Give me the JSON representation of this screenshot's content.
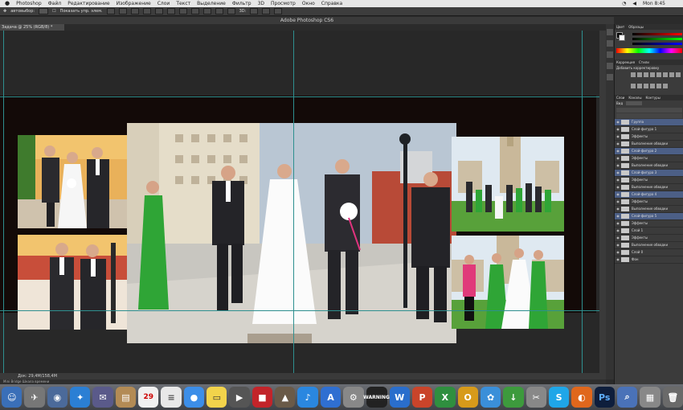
{
  "menubar": {
    "apple": "",
    "items": [
      "Photoshop",
      "Файл",
      "Редактирование",
      "Изображение",
      "Слои",
      "Текст",
      "Выделение",
      "Фильтр",
      "3D",
      "Просмотр",
      "Окно",
      "Справка"
    ],
    "clock": "Mon 8:45"
  },
  "optbar": {
    "label1": "автовыбор:",
    "label2": "Показать упр. элем."
  },
  "window": {
    "title": "Adobe Photoshop CS6",
    "doc_tab": "Задача @ 25% (RGB/8) *",
    "status": "Док: 29,4М/158,4М",
    "status2": "Mini Bridge   Шкала времени"
  },
  "panel": {
    "tabs": [
      "Цвет",
      "Образцы"
    ],
    "adj_tabs": [
      "Коррекция",
      "Стили"
    ],
    "adj_title": "Добавить корректировку",
    "layer_tabs": [
      "Слои",
      "Каналы",
      "Контуры"
    ],
    "kind_label": "Вид",
    "layers": [
      {
        "name": "Группа",
        "selected": true
      },
      {
        "name": "Слой-фигура 1",
        "selected": false
      },
      {
        "name": "Эффекты",
        "selected": false
      },
      {
        "name": "Выполнение обводки",
        "selected": false
      },
      {
        "name": "Слой-фигура 2",
        "selected": true
      },
      {
        "name": "Эффекты",
        "selected": false
      },
      {
        "name": "Выполнение обводки",
        "selected": false
      },
      {
        "name": "Слой-фигура 3",
        "selected": true
      },
      {
        "name": "Эффекты",
        "selected": false
      },
      {
        "name": "Выполнение обводки",
        "selected": false
      },
      {
        "name": "Слой-фигура 4",
        "selected": true
      },
      {
        "name": "Эффекты",
        "selected": false
      },
      {
        "name": "Выполнение обводки",
        "selected": false
      },
      {
        "name": "Слой-фигура 5",
        "selected": true
      },
      {
        "name": "Эффекты",
        "selected": false
      },
      {
        "name": "Слой 1",
        "selected": false
      },
      {
        "name": "Эффекты",
        "selected": false
      },
      {
        "name": "Выполнение обводки",
        "selected": false
      },
      {
        "name": "Слой 0",
        "selected": false
      },
      {
        "name": "Фон",
        "selected": false
      }
    ]
  },
  "colors": {
    "panel_selected": "#4c5f86",
    "guide": "#2e8f8f",
    "spread_bg": "#130a08"
  },
  "dock": {
    "calendar_day": "29",
    "ps_label": "Ps",
    "warning_label": "WARNING"
  }
}
